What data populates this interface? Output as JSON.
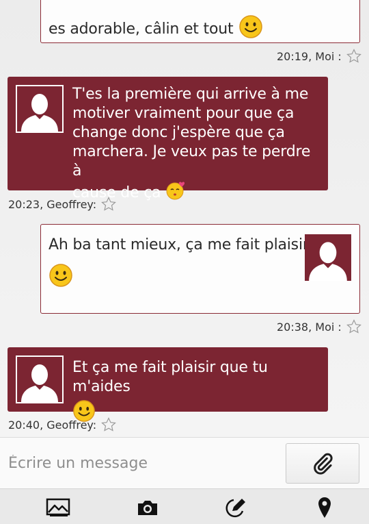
{
  "messages": [
    {
      "id": 1,
      "direction": "out",
      "lines": [
        "es adorable,  câlin et tout"
      ],
      "meta": "20:19, Moi :"
    },
    {
      "id": 2,
      "direction": "in",
      "lines": [
        "T'es la première qui arrive à me",
        "motiver vraiment pour que ça",
        "change donc j'espère que ça",
        "marchera. Je veux pas te perdre à",
        "cause de ça"
      ],
      "meta": "20:23, Geoffrey:"
    },
    {
      "id": 3,
      "direction": "out",
      "lines": [
        "Ah ba tant mieux, ça me fait plaisir"
      ],
      "meta": "20:38, Moi :"
    },
    {
      "id": 4,
      "direction": "in",
      "lines": [
        "Et ça me fait plaisir que tu m'aides"
      ],
      "meta": "20:40, Geoffrey:"
    }
  ],
  "compose": {
    "placeholder": "Écrire un message"
  },
  "toolbar": {
    "icons": [
      "image-icon",
      "camera-icon",
      "draw-icon",
      "location-pin-icon"
    ]
  },
  "colors": {
    "accent": "#7c2532",
    "outgoing_bg": "#fdfdfd",
    "background": "#f1f1f1"
  }
}
